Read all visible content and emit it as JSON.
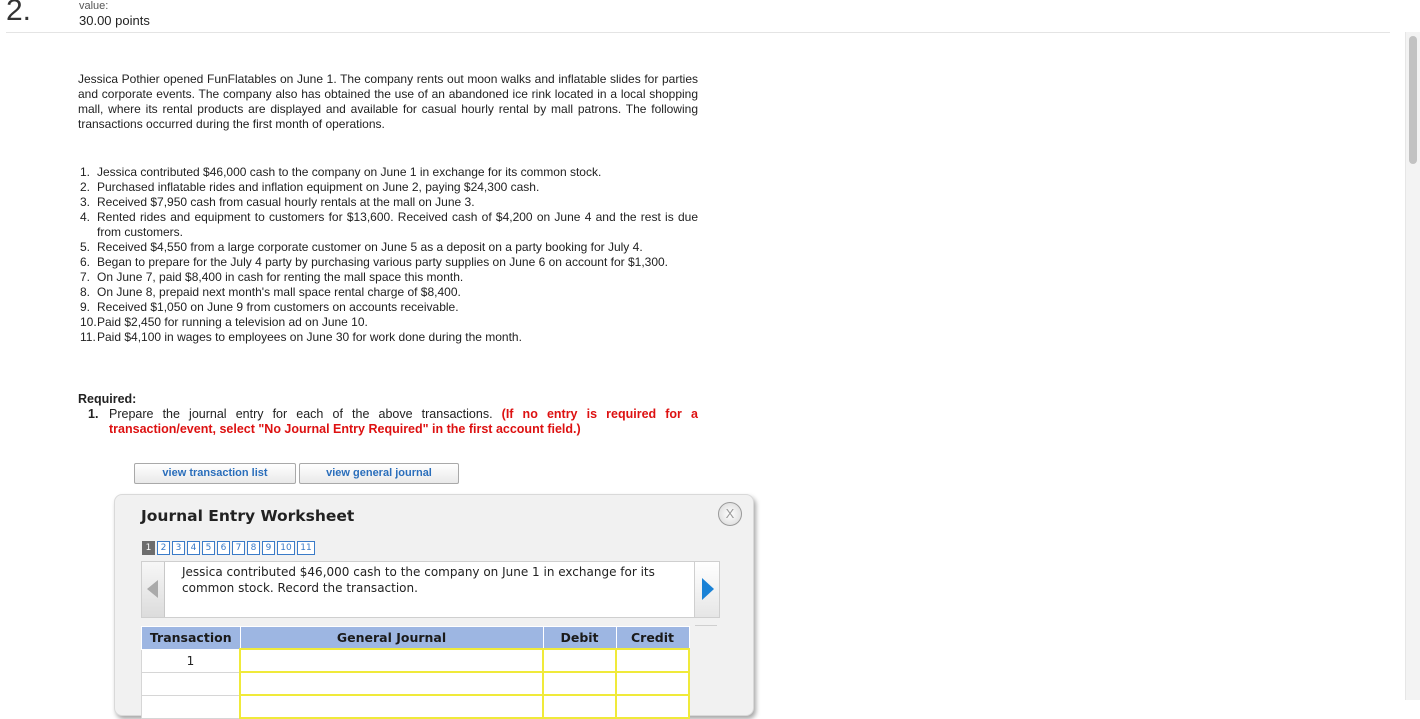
{
  "question": {
    "number": "2.",
    "value_label": "value:",
    "value_points": "30.00 points"
  },
  "intro": "Jessica Pothier opened FunFlatables on June 1. The company rents out moon walks and inflatable slides for parties and corporate events. The company also has obtained the use of an abandoned ice rink located in a local shopping mall, where its rental products are displayed and available for casual hourly rental by mall patrons. The following transactions occurred during the first month of operations.",
  "transactions": [
    {
      "num": "1.",
      "text": "Jessica contributed $46,000 cash to the company on June 1 in exchange for its common stock."
    },
    {
      "num": "2.",
      "text": "Purchased inflatable rides and inflation equipment on June 2, paying $24,300 cash."
    },
    {
      "num": "3.",
      "text": "Received $7,950 cash from casual hourly rentals at the mall on June 3."
    },
    {
      "num": "4.",
      "text": "Rented rides and equipment to customers for $13,600. Received cash of $4,200 on June 4 and the rest is due from customers."
    },
    {
      "num": "5.",
      "text": "Received $4,550 from a large corporate customer on June 5 as a deposit on a party booking for July 4."
    },
    {
      "num": "6.",
      "text": "Began to prepare for the July 4 party by purchasing various party supplies on June 6 on account for $1,300."
    },
    {
      "num": "7.",
      "text": "On June 7, paid $8,400 in cash for renting the mall space this month."
    },
    {
      "num": "8.",
      "text": "On June 8, prepaid next month's mall space rental charge of $8,400."
    },
    {
      "num": "9.",
      "text": "Received $1,050 on June 9 from customers on accounts receivable."
    },
    {
      "num": "10.",
      "text": "Paid $2,450 for running a television ad on June 10."
    },
    {
      "num": "11.",
      "text": "Paid $4,100 in wages to employees on June 30 for work done during the month."
    }
  ],
  "required": {
    "heading": "Required:",
    "num": "1.",
    "text": "Prepare the journal entry for each of the above transactions.",
    "note": "(If no entry is required for a transaction/event, select \"No Journal Entry Required\" in the first account field.)"
  },
  "buttons": {
    "view_transactions": "view transaction list",
    "view_journal": "view general journal"
  },
  "worksheet": {
    "title": "Journal Entry Worksheet",
    "close_label": "X",
    "pages": [
      "1",
      "2",
      "3",
      "4",
      "5",
      "6",
      "7",
      "8",
      "9",
      "10",
      "11"
    ],
    "current_page": "1",
    "description": "Jessica contributed $46,000 cash to the company on June 1 in exchange for its common stock. Record the transaction.",
    "columns": [
      "Transaction",
      "General Journal",
      "Debit",
      "Credit"
    ],
    "rows": [
      {
        "transaction": "1",
        "account": "",
        "debit": "",
        "credit": ""
      },
      {
        "transaction": "",
        "account": "",
        "debit": "",
        "credit": ""
      },
      {
        "transaction": "",
        "account": "",
        "debit": "",
        "credit": ""
      }
    ]
  }
}
